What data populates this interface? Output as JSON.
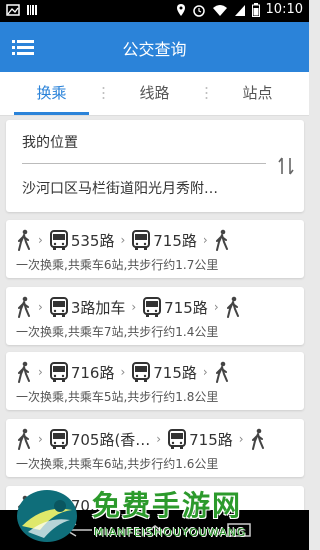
{
  "status_bar": {
    "time": "10:10"
  },
  "app_bar": {
    "title": "公交查询"
  },
  "tabs": [
    {
      "label": "换乘",
      "active": true
    },
    {
      "label": "线路",
      "active": false
    },
    {
      "label": "站点",
      "active": false
    }
  ],
  "location": {
    "from": "我的位置",
    "to": "沙河口区马栏街道阳光月秀附…"
  },
  "routes": [
    {
      "lines": [
        "535路",
        "715路"
      ],
      "summary": "一次换乘,共乘车6站,共步行约1.7公里"
    },
    {
      "lines": [
        "3路加车",
        "715路"
      ],
      "summary": "一次换乘,共乘车7站,共步行约1.4公里"
    },
    {
      "lines": [
        "716路",
        "715路"
      ],
      "summary": "一次换乘,共乘车5站,共步行约1.8公里"
    },
    {
      "lines": [
        "705路(香…",
        "715路"
      ],
      "summary": "一次换乘,共乘车6站,共步行约1.6公里"
    },
    {
      "lines": [
        "70…"
      ],
      "summary": ""
    }
  ],
  "watermark": {
    "title": "免费手游网",
    "subtitle": "MIANFEISHOUYOUWANG"
  },
  "colors": {
    "primary": "#2b83d9",
    "background": "#e9e9e9",
    "watermark_green": "#2c9a2c"
  }
}
